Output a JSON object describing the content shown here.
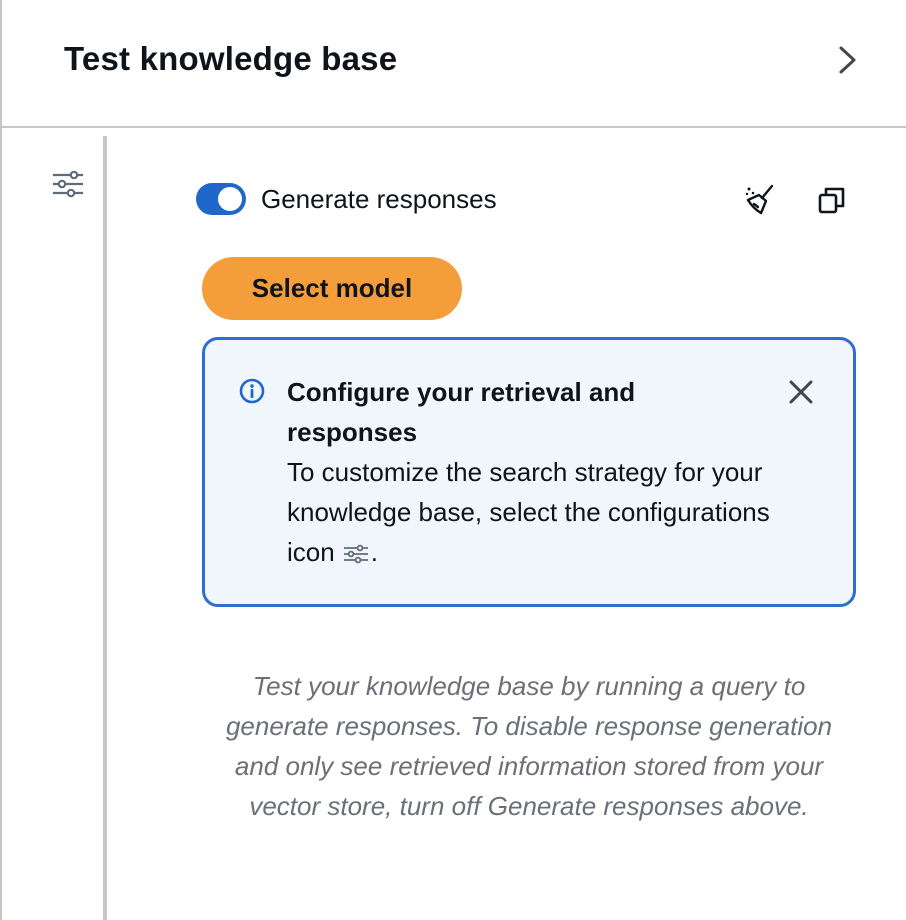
{
  "header": {
    "title": "Test knowledge base",
    "collapse_icon": "chevron-right-icon"
  },
  "rail": {
    "config_icon": "settings-sliders-icon"
  },
  "toolbar": {
    "toggle_label": "Generate responses",
    "toggle_on": true,
    "clear_icon": "broom-icon",
    "copy_icon": "copy-icon"
  },
  "select_model": {
    "label": "Select model"
  },
  "info_alert": {
    "icon": "info-circle-icon",
    "title": "Configure your retrieval and responses",
    "body_prefix": "To customize the search strategy for your knowledge base, select the configurations icon",
    "body_suffix": ".",
    "dismiss_icon": "close-icon"
  },
  "help_text": "Test your knowledge base by running a query to generate responses. To disable response generation and only see retrieved information stored from your vector store, turn off Generate responses above.",
  "colors": {
    "accent_blue": "#1f67c8",
    "button_orange": "#f49d3b",
    "alert_border": "#2f6ecf",
    "alert_bg": "#f1f6fc",
    "divider": "#c6c6cd",
    "muted_text": "#6b6f76"
  }
}
